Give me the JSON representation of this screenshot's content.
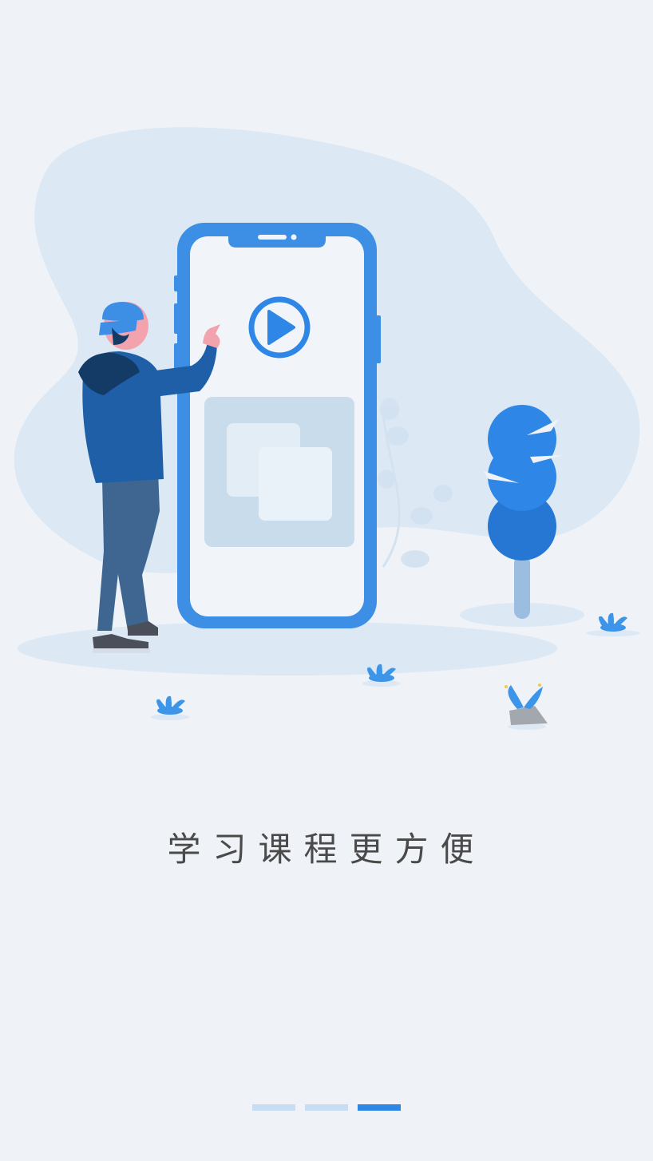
{
  "onboarding": {
    "slogan": "学习课程更方便",
    "current_page": 3,
    "total_pages": 3
  },
  "colors": {
    "background": "#eff3f7",
    "accent": "#2e86e6",
    "indicator_inactive": "#c8dcf3"
  },
  "icons": [
    "play-icon",
    "plant-icon",
    "tree-icon"
  ]
}
